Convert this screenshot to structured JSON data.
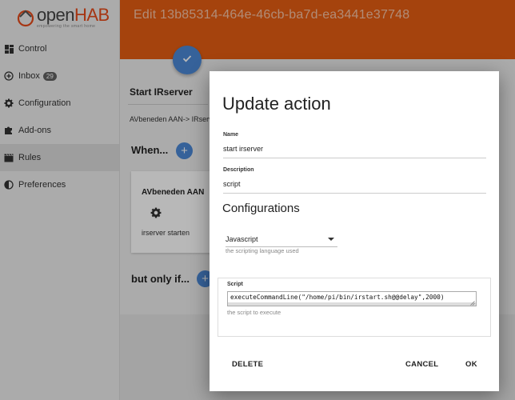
{
  "app": {
    "brand_prefix": "open",
    "brand_name": "HAB",
    "tagline": "empowering the smart home"
  },
  "header": {
    "title": "Edit 13b85314-464e-46cb-ba7d-ea3441e37748"
  },
  "colors": {
    "header": "#e55e12",
    "accent": "#4b88d6"
  },
  "sidebar": {
    "items": [
      {
        "label": "Control",
        "icon": "grid-icon"
      },
      {
        "label": "Inbox",
        "icon": "add-circle-icon",
        "badge": "29"
      },
      {
        "label": "Configuration",
        "icon": "gear-icon"
      },
      {
        "label": "Add-ons",
        "icon": "puzzle-icon"
      },
      {
        "label": "Rules",
        "icon": "clapperboard-icon",
        "active": true
      },
      {
        "label": "Preferences",
        "icon": "contrast-icon"
      }
    ]
  },
  "rule": {
    "name": "Start IRserver",
    "description": "AVbeneden AAN-> IRserv",
    "when_label": "When...",
    "but_only_if_label": "but only if...",
    "trigger_card": {
      "title": "AVbeneden AAN",
      "subtitle": "irserver starten"
    }
  },
  "dialog": {
    "title": "Update action",
    "name_label": "Name",
    "name_value": "start irserver",
    "description_label": "Description",
    "description_value": "script",
    "configurations_title": "Configurations",
    "language_value": "Javascript",
    "language_hint": "the scripting language used",
    "script_label": "Script",
    "script_value": "executeCommandLine(\"/home/pi/bin/irstart.sh@@delay\",2000)",
    "script_hint": "the script to execute",
    "delete_label": "DELETE",
    "cancel_label": "CANCEL",
    "ok_label": "OK"
  }
}
